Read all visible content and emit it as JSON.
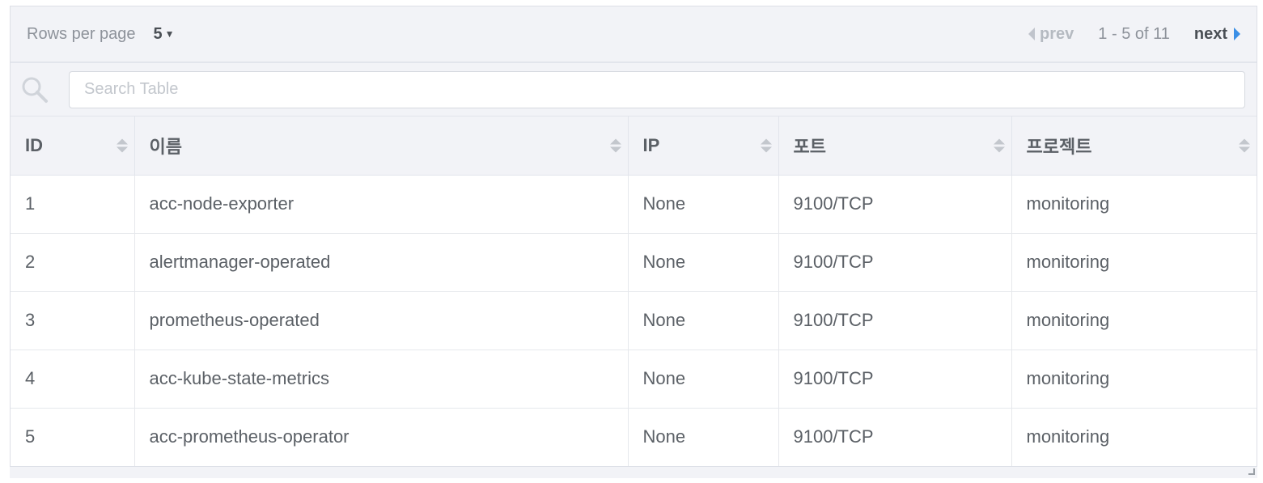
{
  "pagination": {
    "rows_per_page_label": "Rows per page",
    "rows_per_page_value": "5",
    "prev_label": "prev",
    "range_text": "1 - 5 of 11",
    "next_label": "next"
  },
  "search": {
    "placeholder": "Search Table",
    "value": ""
  },
  "table": {
    "columns": [
      "ID",
      "이름",
      "IP",
      "포트",
      "프로젝트"
    ],
    "rows": [
      [
        "1",
        "acc-node-exporter",
        "None",
        "9100/TCP",
        "monitoring"
      ],
      [
        "2",
        "alertmanager-operated",
        "None",
        "9100/TCP",
        "monitoring"
      ],
      [
        "3",
        "prometheus-operated",
        "None",
        "9100/TCP",
        "monitoring"
      ],
      [
        "4",
        "acc-kube-state-metrics",
        "None",
        "9100/TCP",
        "monitoring"
      ],
      [
        "5",
        "acc-prometheus-operator",
        "None",
        "9100/TCP",
        "monitoring"
      ]
    ]
  },
  "icons": {
    "search": "search-icon",
    "sort": "sort-icon",
    "prev": "caret-left-icon",
    "next": "caret-right-icon",
    "dropdown": "caret-down-icon"
  },
  "colors": {
    "accent": "#3b8fe6",
    "header_bg": "#f2f3f7"
  }
}
